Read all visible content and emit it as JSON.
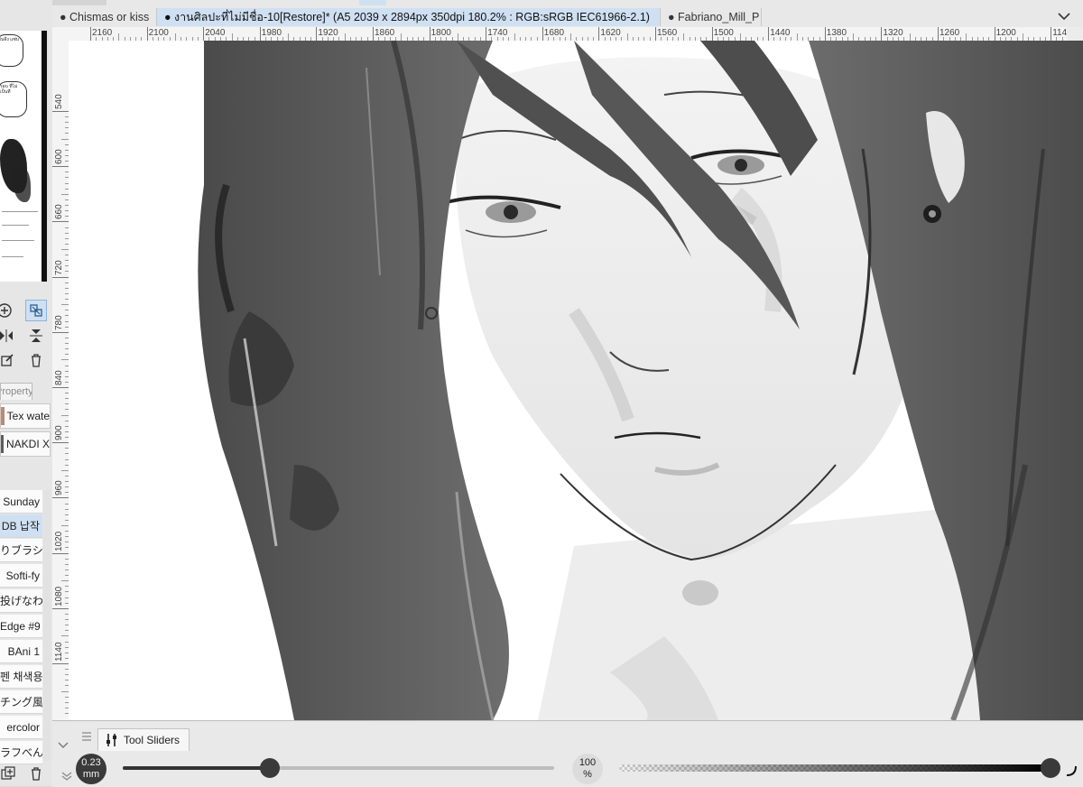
{
  "tabs": [
    {
      "label": "Chismas or kiss",
      "active": false
    },
    {
      "label": "งานศิลปะที่ไม่มีชื่อ-10[Restore]* (A5 2039 x 2894px 350dpi 180.2% : RGB:sRGB IEC61966-2.1)",
      "active": true
    },
    {
      "label": "Fabriano_Mill_P",
      "active": false
    }
  ],
  "ruler": {
    "horizontal": [
      "2160",
      "2100",
      "2040",
      "1980",
      "1920",
      "1860",
      "1800",
      "1740",
      "1680",
      "1620",
      "1560",
      "1500",
      "1440",
      "1380",
      "1320",
      "1260",
      "1200",
      "114"
    ],
    "vertical": [
      "540",
      "600",
      "660",
      "720",
      "780",
      "840",
      "900",
      "960",
      "1020",
      "1080",
      "1140"
    ]
  },
  "navigator": {
    "bubble1": "อันจึง แซ่บ",
    "bubble2": "รอบ ที่ไม่ เป็นที่"
  },
  "left_panel": {
    "property_tab": "Property",
    "materials": [
      "Tex wate",
      "NAKDI X"
    ],
    "brushes": [
      "Sunday",
      "DB 납작",
      "りブラシ",
      "Softi-fy",
      "投げなわ",
      "Edge #9",
      "BAni 1",
      "펜 채색용",
      "チング風",
      "ercolor",
      "ラフべん"
    ]
  },
  "tool_panel": {
    "tab_label": "Tool Sliders",
    "size_value": "0.23",
    "size_unit": "mm",
    "opacity_value": "100",
    "opacity_unit": "%",
    "size_fraction": 0.34,
    "opacity_fraction": 1.0
  },
  "colors": {
    "accent_tab": "#cfe0f2",
    "panel_bg": "#e9e9e9",
    "knob": "#3a3a3a"
  }
}
